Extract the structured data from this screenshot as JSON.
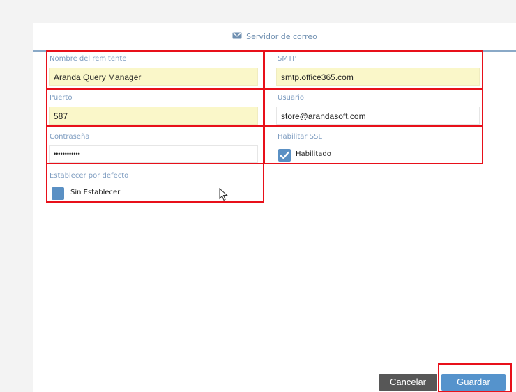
{
  "header": {
    "title": "Servidor de correo",
    "icon": "mail-icon"
  },
  "fields": {
    "sender": {
      "label": "Nombre del remitente",
      "value": "Aranda Query Manager"
    },
    "smtp": {
      "label": "SMTP",
      "value": "smtp.office365.com"
    },
    "port": {
      "label": "Puerto",
      "value": "587"
    },
    "user": {
      "label": "Usuario",
      "value": "store@arandasoft.com"
    },
    "password": {
      "label": "Contraseña",
      "value": "••••••••••••"
    },
    "ssl": {
      "label": "Habilitar SSL",
      "option": "Habilitado",
      "checked": true
    },
    "default": {
      "label": "Establecer por defecto",
      "option": "Sin Establecer",
      "checked": false
    }
  },
  "actions": {
    "cancel": "Cancelar",
    "save": "Guardar"
  },
  "colors": {
    "highlight": "#e8101a",
    "accent": "#5a90c4",
    "field_highlight": "#faf7c9"
  }
}
